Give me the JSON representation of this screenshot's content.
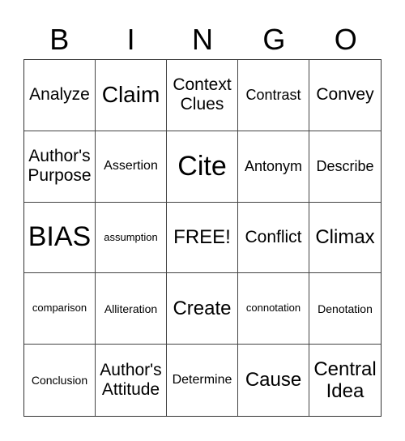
{
  "header": [
    "B",
    "I",
    "N",
    "G",
    "O"
  ],
  "cells": [
    [
      "Analyze",
      "Claim",
      "Context Clues",
      "Contrast",
      "Convey"
    ],
    [
      "Author's Purpose",
      "Assertion",
      "Cite",
      "Antonym",
      "Describe"
    ],
    [
      "BIAS",
      "assumption",
      "FREE!",
      "Conflict",
      "Climax"
    ],
    [
      "comparison",
      "Alliteration",
      "Create",
      "connotation",
      "Denotation"
    ],
    [
      "Conclusion",
      "Author's Attitude",
      "Determine",
      "Cause",
      "Central Idea"
    ]
  ]
}
